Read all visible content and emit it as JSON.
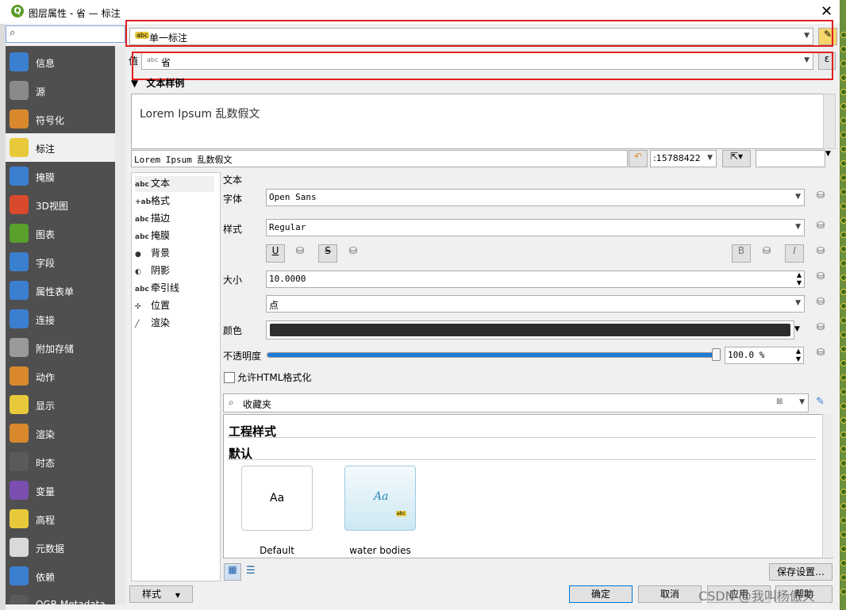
{
  "window": {
    "title": "图层属性 - 省 — 标注",
    "close": "✕"
  },
  "search": {
    "placeholder": ""
  },
  "sidebar": {
    "items": [
      {
        "label": "信息",
        "color": "#3b7fd1"
      },
      {
        "label": "源",
        "color": "#8a8a8a"
      },
      {
        "label": "符号化",
        "color": "#d9882c"
      },
      {
        "label": "标注",
        "color": "#e8c93a",
        "selected": true
      },
      {
        "label": "掩膜",
        "color": "#3b7fd1"
      },
      {
        "label": "3D视图",
        "color": "#d94a2c"
      },
      {
        "label": "图表",
        "color": "#5aa02c"
      },
      {
        "label": "字段",
        "color": "#3b7fd1"
      },
      {
        "label": "属性表单",
        "color": "#3b7fd1"
      },
      {
        "label": "连接",
        "color": "#3b7fd1"
      },
      {
        "label": "附加存储",
        "color": "#9a9a9a"
      },
      {
        "label": "动作",
        "color": "#d9882c"
      },
      {
        "label": "显示",
        "color": "#e8c93a"
      },
      {
        "label": "渲染",
        "color": "#d9882c"
      },
      {
        "label": "时态",
        "color": "#5a5a5a"
      },
      {
        "label": "变量",
        "color": "#7a4fb0"
      },
      {
        "label": "高程",
        "color": "#e8c93a"
      },
      {
        "label": "元数据",
        "color": "#d9d9d9"
      },
      {
        "label": "依赖",
        "color": "#3b7fd1"
      },
      {
        "label": "QGR Metadata",
        "color": "#5a5a5a"
      }
    ]
  },
  "mode_combo": {
    "value": "单一标注"
  },
  "value_row": {
    "label": "值",
    "value": "省"
  },
  "sample": {
    "section": "文本样例",
    "preview": "Lorem Ipsum 乱数假文",
    "input": "Lorem Ipsum 乱数假文",
    "scale": ":15788422"
  },
  "subtabs": [
    {
      "icon": "abc",
      "label": "文本",
      "selected": true
    },
    {
      "icon": "+ab",
      "label": "格式"
    },
    {
      "icon": "abc",
      "label": "描边"
    },
    {
      "icon": "abc",
      "label": "掩膜"
    },
    {
      "icon": "●",
      "label": "背景"
    },
    {
      "icon": "◐",
      "label": "阴影"
    },
    {
      "icon": "abc",
      "label": "牵引线"
    },
    {
      "icon": "✣",
      "label": "位置"
    },
    {
      "icon": "╱",
      "label": "渲染"
    }
  ],
  "text_panel": {
    "heading": "文本",
    "font_label": "字体",
    "font": "Open Sans",
    "style_label": "样式",
    "style": "Regular",
    "u": "U",
    "s": "S",
    "b": "B",
    "i": "I",
    "size_label": "大小",
    "size": "10.0000",
    "unit": "点",
    "color_label": "颜色",
    "color": "#2d2d2d",
    "opacity_label": "不透明度",
    "opacity": "100.0 %",
    "opacity_pct": 100,
    "html_label": "允许HTML格式化"
  },
  "styles": {
    "search": "收藏夹",
    "project_header": "工程样式",
    "default_header": "默认",
    "tiles": [
      {
        "preview": "Aa",
        "name": "Default"
      },
      {
        "preview": "Aa",
        "name": "water bodies"
      }
    ],
    "save_button": "保存设置…"
  },
  "footer": {
    "style_button": "样式",
    "ok": "确定",
    "cancel": "取消",
    "apply": "应用",
    "help": "帮助"
  },
  "watermark": "CSDN @我叫杨傲天"
}
